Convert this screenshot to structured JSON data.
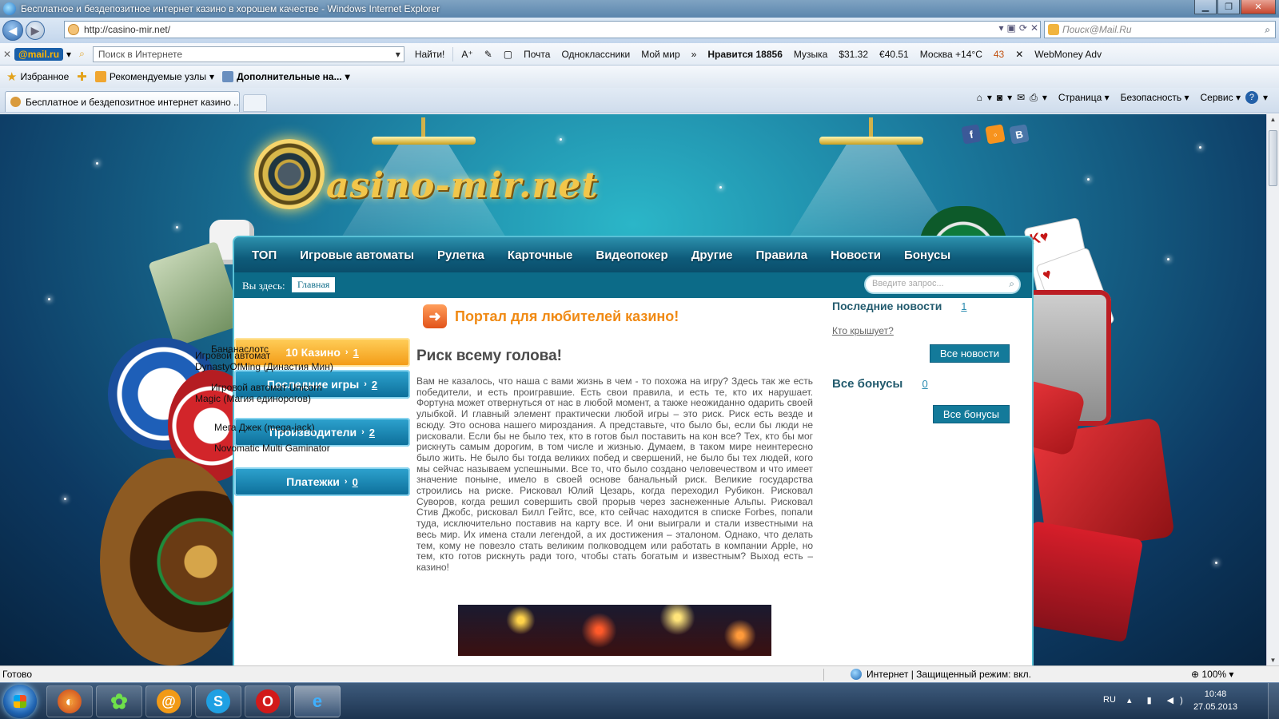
{
  "window": {
    "title": "Бесплатное и бездепозитное интернет казино в хорошем качестве - Windows Internet Explorer"
  },
  "address": {
    "url": "http://casino-mir.net/",
    "search_placeholder": "Поиск@Mail.Ru"
  },
  "mailru_toolbar": {
    "logo": "@mail.ru",
    "search_placeholder": "Поиск в Интернете",
    "find": "Найти!",
    "items": [
      "Почта",
      "Одноклассники",
      "Мой мир"
    ],
    "likes": "Нравится 18856",
    "music": "Музыка",
    "usd": "$31.32",
    "eur": "€40.51",
    "weather": "Москва +14°C",
    "mail_count": "43",
    "webmoney": "WebMoney Adv"
  },
  "favorites_bar": {
    "favorites": "Избранное",
    "suggested": "Рекомендуемые узлы",
    "more": "Дополнительные на..."
  },
  "tab": {
    "title": "Бесплатное и бездепозитное интернет казино ..."
  },
  "command_bar": {
    "page": "Страница",
    "safety": "Безопасность",
    "tools": "Сервис"
  },
  "site": {
    "logo": "asino-mir.net",
    "nav": [
      "ТОП",
      "Игровые автоматы",
      "Рулетка",
      "Карточные",
      "Видеопокер",
      "Другие",
      "Правила",
      "Новости",
      "Бонусы"
    ],
    "breadcrumb_label": "Вы здесь:",
    "breadcrumb_home": "Главная",
    "search_placeholder": "Введите запрос...",
    "left_menu": [
      {
        "label": "10 Казино",
        "count": "1"
      },
      {
        "label": "Последние игры",
        "count": "2"
      },
      {
        "label": "Производители",
        "count": "2"
      },
      {
        "label": "Платежки",
        "count": "0"
      }
    ],
    "overlay_items": [
      "Бананаслотс",
      "Игровой автомат",
      "DynastyOfMing (Династия Мин)",
      "Игровой автомат Unicorn",
      "Magic (Магия единорогов)",
      "Мега Джек (mega-jack)",
      "Novomatic Multi Gaminator"
    ],
    "portal_title": "Портал для любителей казино!",
    "article_title": "Риск всему голова!",
    "article_text": "Вам не казалось, что наша с вами жизнь в чем - то похожа на игру? Здесь так же есть победители, и есть проигравшие. Есть свои правила, и есть те, кто их нарушает. Фортуна может отвернуться от нас в любой момент, а также неожиданно одарить своей улыбкой. И главный элемент практически любой игры – это риск. Риск есть везде и всюду. Это основа нашего мироздания. А представьте, что было бы, если бы люди не рисковали. Если бы не было тех, кто в готов был поставить на кон все? Тех, кто бы мог рискнуть самым дорогим, в том числе и жизнью. Думаем, в таком мире неинтересно было жить. Не было бы тогда великих побед и свершений, не было бы тех людей, кого мы сейчас называем успешными. Все то, что было создано человечеством и что имеет значение поныне, имело в своей основе банальный риск. Великие государства строились на риске. Рисковал Юлий Цезарь, когда переходил Рубикон. Рисковал Суворов, когда решил совершить свой прорыв через заснеженные Альпы. Рисковал Стив Джобс, рисковал Билл Гейтс, все, кто сейчас находится в списке Forbes, попали туда, исключительно поставив на карту все. И они выиграли и стали известными на весь мир. Их имена стали легендой, а их достижения – эталоном. Однако, что делать тем, кому не повезло стать великим полководцем или работать в компании Apple, но тем, кто готов рискнуть ради того, чтобы стать богатым и известным? Выход есть – казино!",
    "news_title": "Последние новости",
    "news_count": "1",
    "news_link": "Кто крышует?",
    "news_button": "Все новости",
    "bonus_title": "Все бонусы",
    "bonus_count": "0",
    "bonus_button": "Все бонусы"
  },
  "status": {
    "ready": "Готово",
    "zone": "Интернет | Защищенный режим: вкл.",
    "zoom": "100%"
  },
  "taskbar": {
    "lang": "RU",
    "time": "10:48",
    "date": "27.05.2013"
  }
}
